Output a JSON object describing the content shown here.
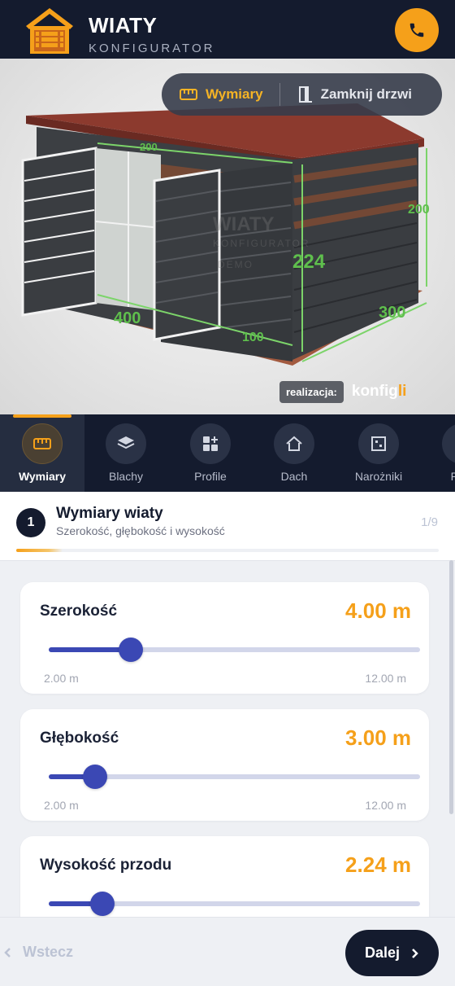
{
  "header": {
    "title": "WIATY",
    "subtitle": "KONFIGURATOR"
  },
  "viewer": {
    "toolbar": {
      "dimensions_label": "Wymiary",
      "close_doors_label": "Zamknij drzwi"
    },
    "model_labels": {
      "top_width": "200",
      "height": "224",
      "side_height": "200",
      "depth": "300",
      "front_left": "400",
      "front_right": "100"
    },
    "watermark": {
      "title": "WIATY",
      "subtitle": "KONFIGURATOR",
      "tag": "DEMO"
    },
    "badge": {
      "label": "realizacja:",
      "brand": "konfig",
      "brand_accent": "li"
    }
  },
  "categories": [
    {
      "label": "Wymiary",
      "icon": "ruler-icon",
      "active": true
    },
    {
      "label": "Blachy",
      "icon": "layers-icon",
      "active": false
    },
    {
      "label": "Profile",
      "icon": "grid-plus-icon",
      "active": false
    },
    {
      "label": "Dach",
      "icon": "roof-icon",
      "active": false
    },
    {
      "label": "Narożniki",
      "icon": "corner-icon",
      "active": false
    },
    {
      "label": "Prze",
      "icon": "more-icon",
      "active": false
    }
  ],
  "step": {
    "number": "1",
    "title": "Wymiary wiaty",
    "subtitle": "Szerokość, głębokość i wysokość",
    "counter": "1/9",
    "progress": 0.11
  },
  "sliders": [
    {
      "label": "Szerokość",
      "value_text": "4.00 m",
      "value": 4.0,
      "min": 2.0,
      "max": 12.0,
      "min_label": "2.00 m",
      "max_label": "12.00 m"
    },
    {
      "label": "Głębokość",
      "value_text": "3.00 m",
      "value": 3.0,
      "min": 2.0,
      "max": 12.0,
      "min_label": "2.00 m",
      "max_label": "12.00 m"
    },
    {
      "label": "Wysokość przodu",
      "value_text": "2.24 m",
      "value": 2.24,
      "min": 2.0,
      "max": 4.0,
      "min_label": "",
      "max_label": ""
    }
  ],
  "footer": {
    "back_label": "Wstecz",
    "next_label": "Dalej"
  },
  "colors": {
    "navy": "#141b2e",
    "accent": "#f5a01a",
    "slider": "#3b48b4"
  }
}
